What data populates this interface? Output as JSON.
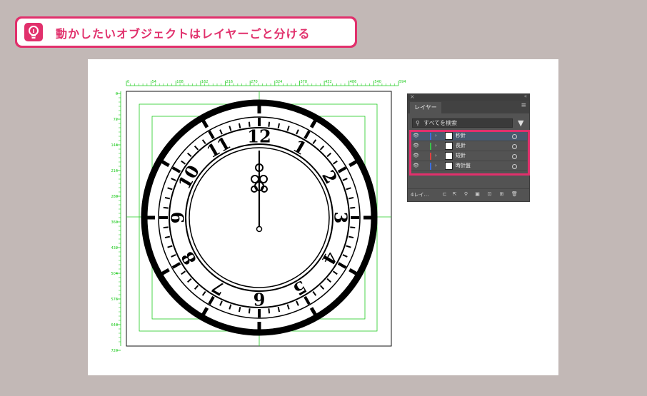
{
  "banner": {
    "title": "動かしたいオブジェクトはレイヤーごと分ける",
    "icon": "lightbulb-icon",
    "accent_color": "#e1306c"
  },
  "rulers": {
    "top_ticks": [
      "0",
      "54",
      "108",
      "162",
      "216",
      "270",
      "324",
      "378",
      "432",
      "486",
      "540",
      "594"
    ],
    "left_ticks": [
      "0",
      "72",
      "144",
      "216",
      "288",
      "360",
      "432",
      "504",
      "576",
      "648",
      "720"
    ],
    "guide_color": "#22cc22"
  },
  "clock": {
    "numerals": [
      "12",
      "1",
      "2",
      "3",
      "4",
      "5",
      "6",
      "7",
      "8",
      "9",
      "10",
      "11"
    ]
  },
  "layers_panel": {
    "tab_label": "レイヤー",
    "search_placeholder": "すべてを検索",
    "layers": [
      {
        "name": "秒針",
        "color": "#3b6fe0",
        "selected": true
      },
      {
        "name": "長針",
        "color": "#39c24a",
        "selected": false
      },
      {
        "name": "短針",
        "color": "#e04040",
        "selected": false
      },
      {
        "name": "時計盤",
        "color": "#3b6fe0",
        "selected": false
      }
    ],
    "footer_count": "4レイ…"
  }
}
